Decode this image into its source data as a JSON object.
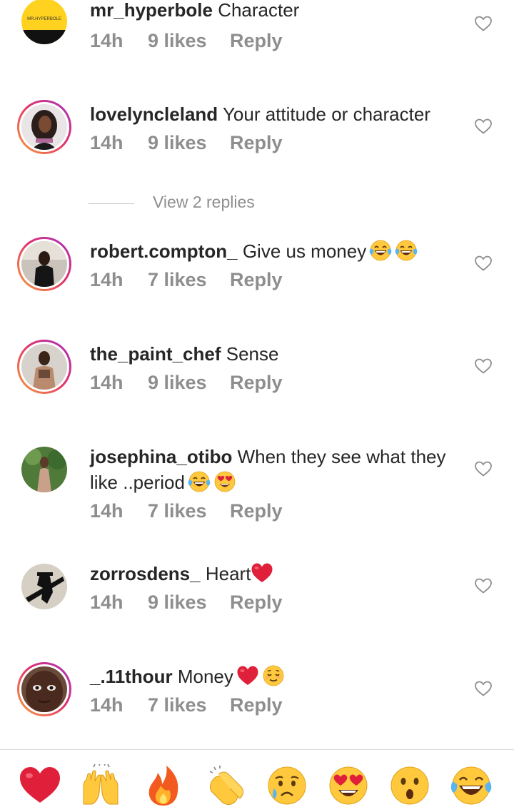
{
  "comments": [
    {
      "username": "mr_hyperbole",
      "text": "Character",
      "time": "14h",
      "likes": "9 likes",
      "reply": "Reply",
      "avatar_text": "MR.HYPERBOLE"
    },
    {
      "username": "lovelyncleland",
      "text": "Your attitude or character",
      "time": "14h",
      "likes": "9 likes",
      "reply": "Reply"
    },
    {
      "username": "robert.compton_",
      "text": "Give us money",
      "time": "14h",
      "likes": "7 likes",
      "reply": "Reply"
    },
    {
      "username": "the_paint_chef",
      "text": "Sense",
      "time": "14h",
      "likes": "9 likes",
      "reply": "Reply"
    },
    {
      "username": "josephina_otibo",
      "text": "When they see what they like ..period",
      "time": "14h",
      "likes": "7 likes",
      "reply": "Reply"
    },
    {
      "username": "zorrosdens_",
      "text": "Heart",
      "time": "14h",
      "likes": "9 likes",
      "reply": "Reply"
    },
    {
      "username": "_.11thour",
      "text": "Money",
      "time": "14h",
      "likes": "7 likes",
      "reply": "Reply"
    }
  ],
  "view_replies": "View 2 replies",
  "emoji": {
    "c2": [
      "laughing-crying-emoji",
      "laughing-crying-emoji"
    ],
    "c4": [
      "laughing-crying-emoji",
      "heart-eyes-emoji"
    ],
    "c5": [
      "red-heart-emoji"
    ],
    "c6": [
      "red-heart-emoji",
      "relieved-face-emoji"
    ]
  },
  "reactions": [
    "red-heart",
    "raising-hands",
    "fire",
    "clapping-hands",
    "crying-face",
    "heart-eyes",
    "surprised-face",
    "laughing-crying"
  ],
  "colors": {
    "text": "#262626",
    "meta": "#8e8e8e",
    "heart": "#e0203a",
    "emoji_yellow": "#ffc83d",
    "story_ring": "#e1306c"
  }
}
